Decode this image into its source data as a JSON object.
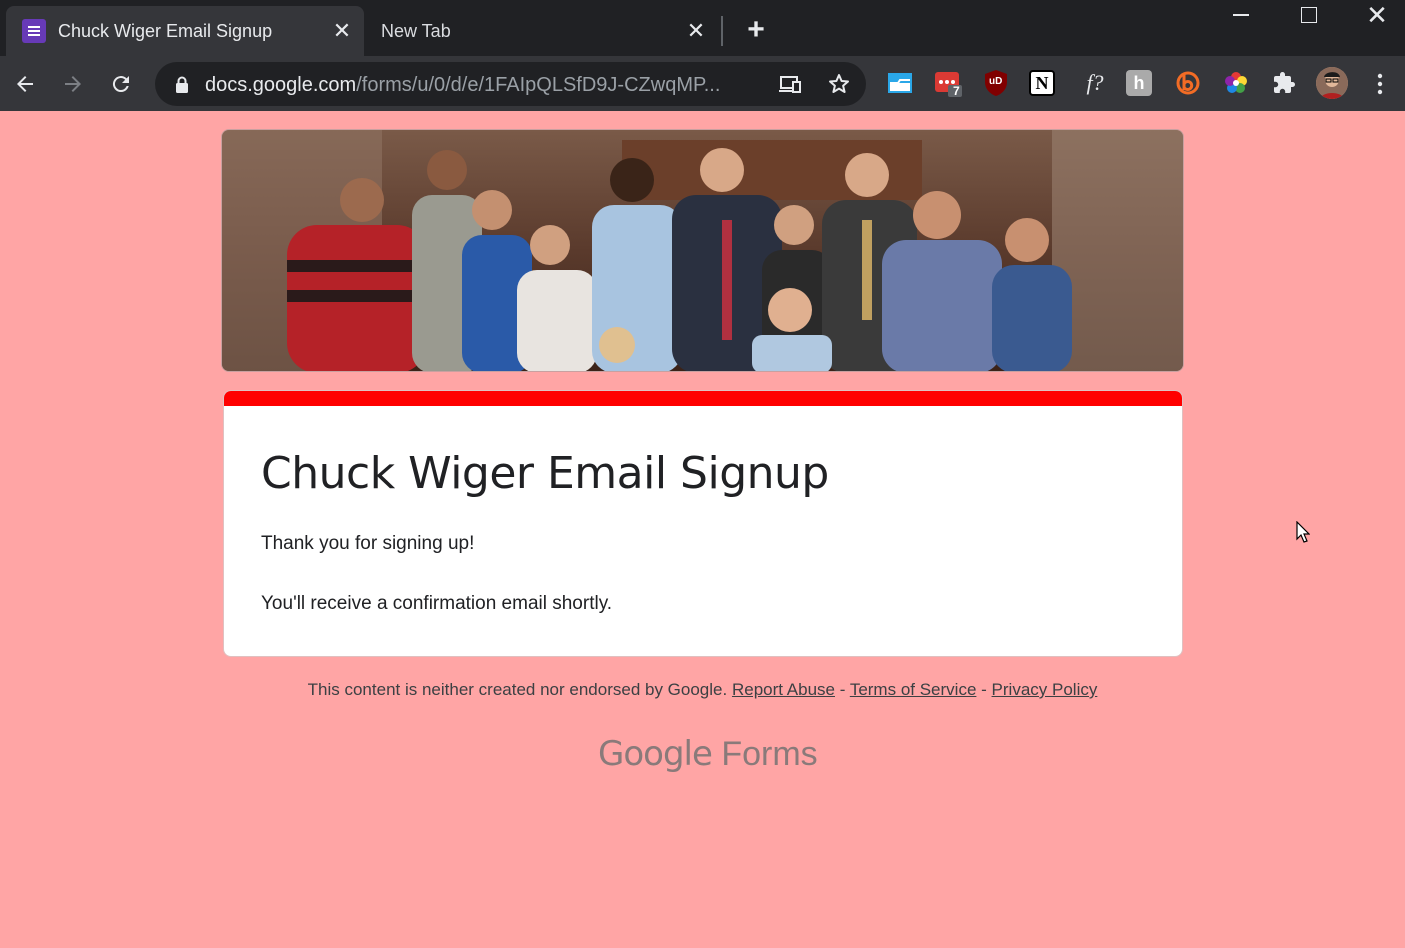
{
  "browser": {
    "tabs": [
      {
        "title": "Chuck Wiger Email Signup",
        "active": true,
        "icon": "google-forms-icon"
      },
      {
        "title": "New Tab",
        "active": false
      }
    ],
    "tab_close_glyph": "✕",
    "new_tab_glyph": "+",
    "url_host": "docs.google.com",
    "url_path": "/forms/u/0/d/e/1FAIpQLSfD9J-CZwqMP...",
    "extensions": [
      {
        "name": "screen-capture-extension-icon"
      },
      {
        "name": "todo-extension-icon",
        "badge": "7"
      },
      {
        "name": "ublock-extension-icon",
        "label": "uD"
      },
      {
        "name": "notion-extension-icon",
        "label": "N"
      },
      {
        "name": "formula-extension-icon",
        "label": "f?"
      },
      {
        "name": "h-extension-icon",
        "label": "h"
      },
      {
        "name": "honey-extension-icon",
        "label": "b"
      },
      {
        "name": "color-wheel-extension-icon"
      },
      {
        "name": "puzzle-extensions-icon"
      }
    ]
  },
  "form": {
    "banner_alt": "group photo",
    "accent_color": "#ff0000",
    "page_background": "#ffa5a5",
    "title": "Chuck Wiger Email Signup",
    "message_line1": "Thank you for signing up!",
    "message_line2": "You'll receive a confirmation email shortly."
  },
  "footer": {
    "disclaimer": "This content is neither created nor endorsed by Google.",
    "report_abuse": "Report Abuse",
    "sep": "-",
    "terms": "Terms of Service",
    "privacy": "Privacy Policy",
    "brand_google": "Google",
    "brand_forms": "Forms"
  }
}
